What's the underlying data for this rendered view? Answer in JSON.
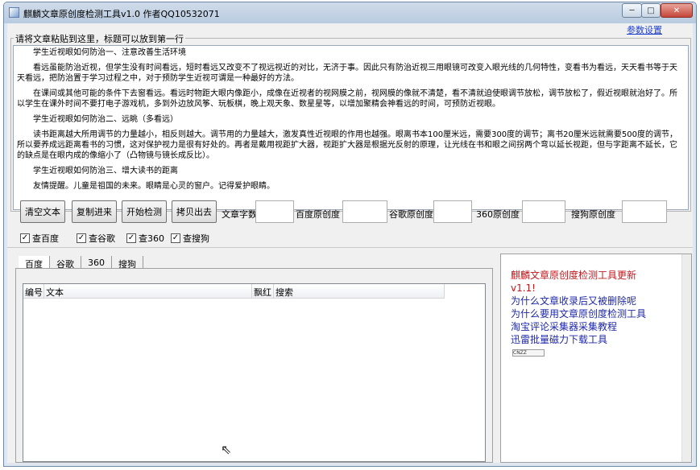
{
  "window": {
    "title": "麒麟文章原创度检测工具v1.0 作者QQ10532071",
    "minimize_glyph": "─",
    "maximize_glyph": "□",
    "close_glyph": "✕"
  },
  "settings_link": "参数设置",
  "article_group": {
    "legend": "请将文章粘贴到这里，标题可以放到第一行",
    "paragraphs": [
      "学生近视眼如何防治一、注意改善生活环境",
      "看远虽能防治近视，但学生没有时间看远，短时看远又改变不了视远视近的对比，无济于事。因此只有防治近视三用眼镜可改变入眼光线的几何特性，变看书为看远，天天看书等于天天看远，把防治置于学习过程之中，对于预防学生近视可谓是一种最好的方法。",
      "在课间或其他可能的条件下去窗看远。看远时物距大眼内像距小，成像在近视者的视网膜之前，视网膜的像就不清楚，看不清就迫使眼调节放松，调节放松了，假近视眼就治好了。所以学生在课外时间不要打电子游戏机，多到外边放风筝、玩板棋，晚上观天象、数星星等，以增加聚精会神看远的时间，可预防近视眼。",
      "学生近视眼如何防治二、远眺（多看远）",
      "读书距离越大所用调节的力量越小，相反则越大。调节用的力量越大，激发真性近视眼的作用也越强。眼离书本100厘米远，需要300度的调节；离书20厘米远就需要500度的调节，所以要养成远距离看书的习惯，这对保护视力是很有好处的。再者是戴用视距扩大器，视距扩大器是根据光反射的原理，让光线在书和眼之间拐两个弯以延长视距，但与字距离不延长，它的缺点是在眼内成的像缩小了（凸物镜与镜长成反比）。",
      "学生近视眼如何防治三、增大读书的距离",
      "友情提醒。儿童是祖国的未来。眼睛是心灵的窗户。记得爱护眼睛。"
    ]
  },
  "buttons": {
    "clear": "清空文本",
    "paste": "复制进来",
    "start": "开始检测",
    "copy_out": "拷贝出去"
  },
  "stats": {
    "word_count_label": "文章字数",
    "baidu_label": "百度原创度",
    "google_label": "谷歌原创度",
    "so360_label": "360原创度",
    "sogou_label": "搜狗原创度",
    "word_count_value": "",
    "baidu_value": "",
    "google_value": "",
    "so360_value": "",
    "sogou_value": ""
  },
  "checkboxes": [
    {
      "label": "查百度",
      "checked": true,
      "mark": "✓"
    },
    {
      "label": "查谷歌",
      "checked": true,
      "mark": "✓"
    },
    {
      "label": "查360",
      "checked": true,
      "mark": "✓"
    },
    {
      "label": "查搜狗",
      "checked": true,
      "mark": "✓"
    }
  ],
  "tabs": [
    "百度",
    "谷歌",
    "360",
    "搜狗"
  ],
  "results_table": {
    "columns": [
      "编号",
      "文本",
      "飘红",
      "搜索"
    ],
    "rows": []
  },
  "news": {
    "title_line1": "麒麟文章原创度检测工具更新",
    "title_line2": "v1.1!",
    "links": [
      "为什么文章收录后又被删除呢",
      "为什么要用文章原创度检测工具",
      "淘宝评论采集器采集教程",
      "迅雷批量磁力下载工具"
    ],
    "counter_badge": "CNZZ"
  },
  "colors": {
    "accent_link": "#1d3fcc",
    "news_title": "#c0191e",
    "news_link": "#1f28a8"
  }
}
